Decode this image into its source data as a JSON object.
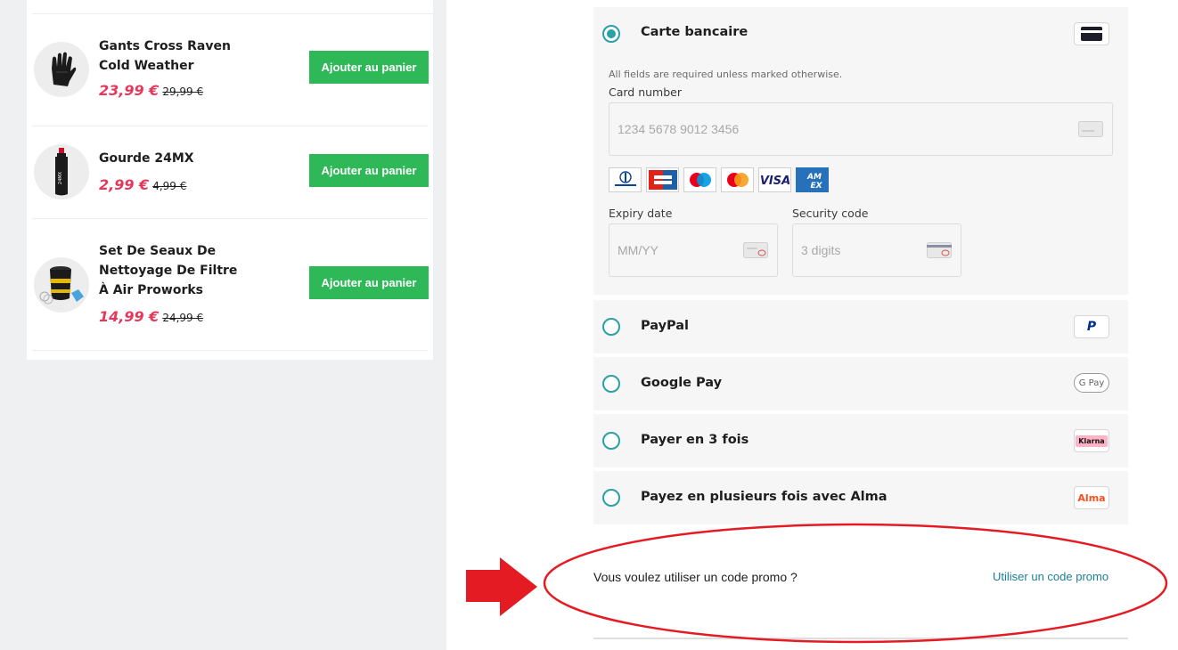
{
  "products": [
    {
      "name": "Gants Cross Raven Cold Weather",
      "price": "23,99 €",
      "old_price": "29,99 €",
      "button": "Ajouter au panier",
      "icon": "glove-icon"
    },
    {
      "name": "Gourde 24MX",
      "price": "2,99 €",
      "old_price": "4,99 €",
      "button": "Ajouter au panier",
      "icon": "bottle-icon"
    },
    {
      "name": "Set De Seaux De Nettoyage De Filtre À Air Proworks",
      "price": "14,99 €",
      "old_price": "24,99 €",
      "button": "Ajouter au panier",
      "icon": "bucket-icon"
    }
  ],
  "payment": {
    "card": {
      "label": "Carte bancaire",
      "selected": true,
      "icon": "credit-card-icon",
      "required_note": "All fields are required unless marked otherwise.",
      "card_number_label": "Card number",
      "card_number_placeholder": "1234 5678 9012 3456",
      "expiry_label": "Expiry date",
      "expiry_placeholder": "MM/YY",
      "security_label": "Security code",
      "security_placeholder": "3 digits",
      "brands": [
        "Diners Club",
        "CB",
        "Maestro",
        "Mastercard",
        "VISA",
        "AMEX"
      ]
    },
    "methods": [
      {
        "label": "PayPal",
        "logo": "P",
        "icon": "paypal-icon"
      },
      {
        "label": "Google Pay",
        "logo": "G Pay",
        "icon": "google-pay-icon"
      },
      {
        "label": "Payer en 3 fois",
        "logo": "Klarna",
        "icon": "klarna-icon"
      },
      {
        "label": "Payez en plusieurs fois avec Alma",
        "logo": "Alma",
        "icon": "alma-icon"
      }
    ]
  },
  "promo": {
    "question": "Vous voulez utiliser un code promo ?",
    "link": "Utiliser un code promo"
  },
  "colors": {
    "accent_teal": "#2aa0a8",
    "add_button": "#2eb857",
    "price_red": "#e5375a",
    "annotation_red": "#e41b23",
    "promo_link": "#1c7f9a"
  }
}
